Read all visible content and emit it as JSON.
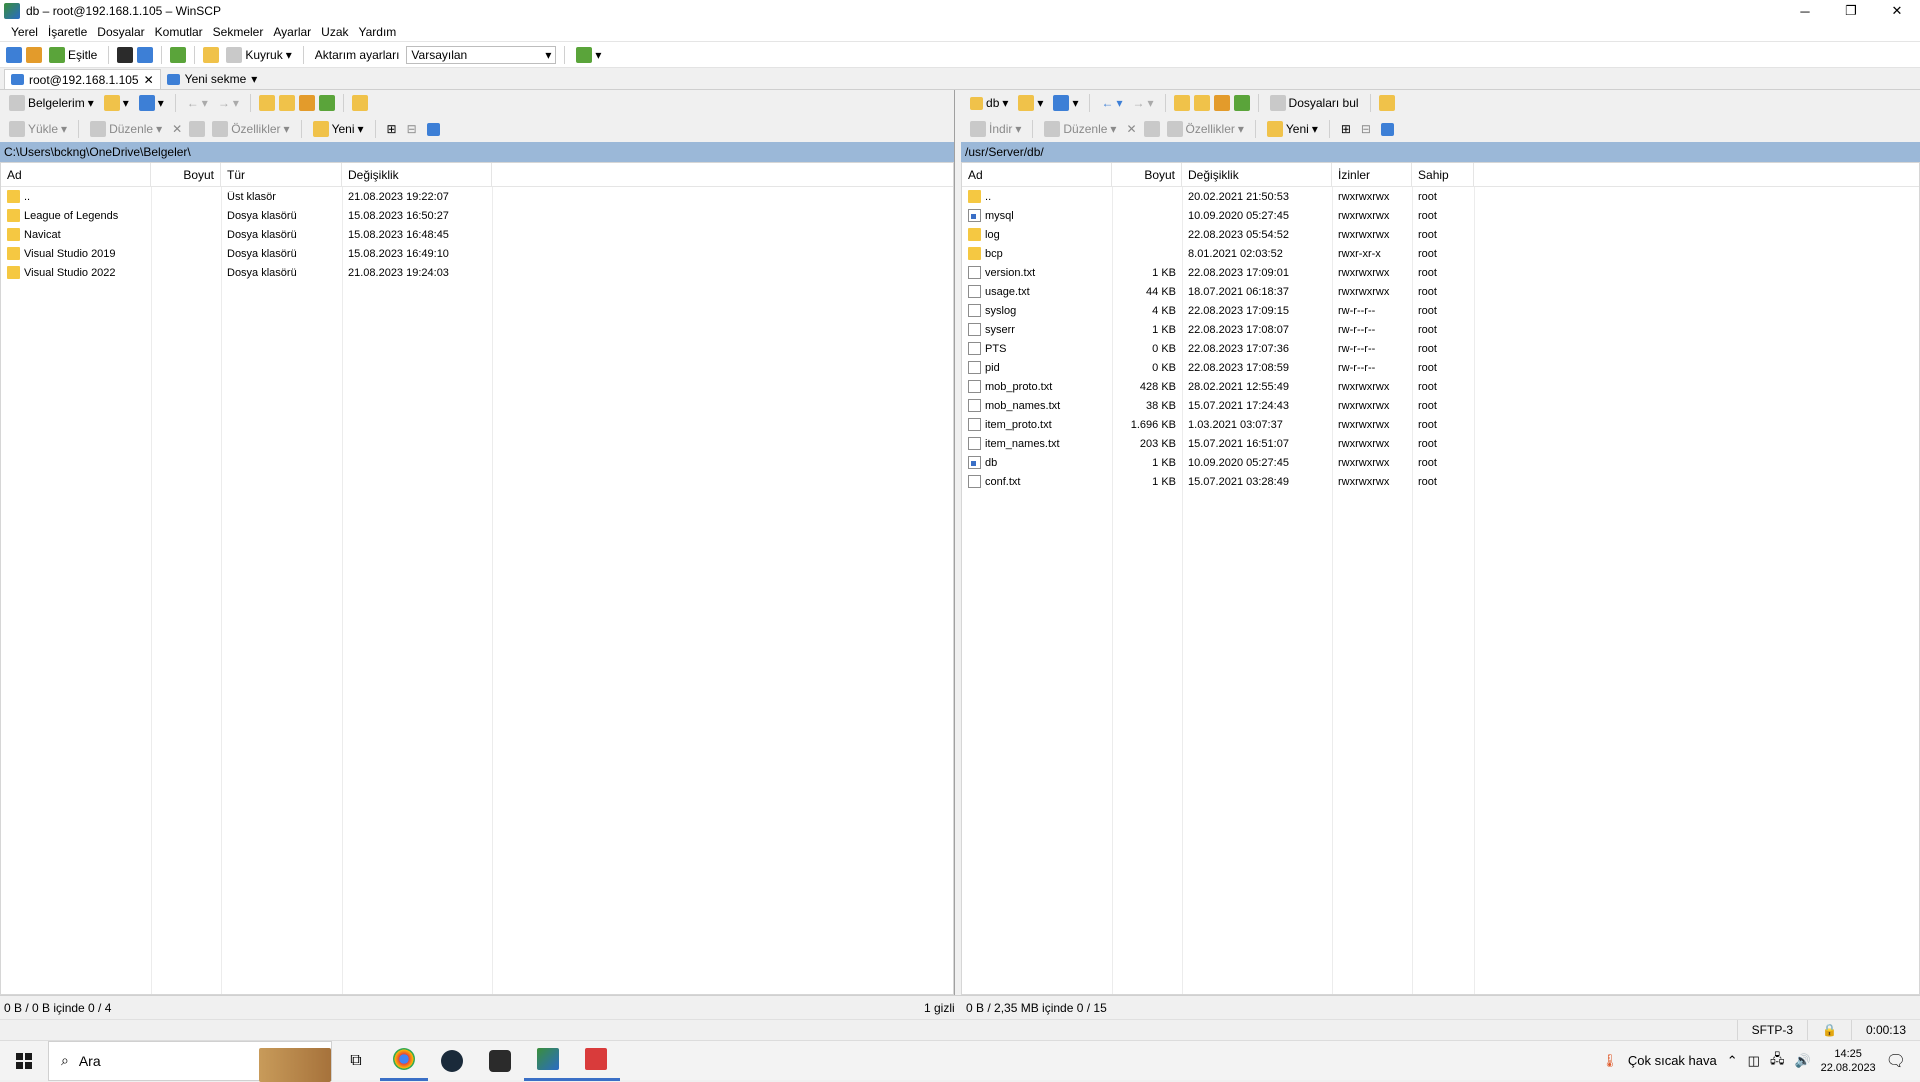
{
  "window": {
    "title": "db – root@192.168.1.105 – WinSCP",
    "minimize": "─",
    "restore": "❐",
    "close": "✕"
  },
  "menu": [
    "Yerel",
    "İşaretle",
    "Dosyalar",
    "Komutlar",
    "Sekmeler",
    "Ayarlar",
    "Uzak",
    "Yardım"
  ],
  "toolbar": {
    "sync_label": "Eşitle",
    "queue_label": "Kuyruk",
    "transfer_label": "Aktarım ayarları",
    "transfer_value": "Varsayılan"
  },
  "tabs": [
    {
      "label": "root@192.168.1.105",
      "close": "✕"
    },
    {
      "label": "Yeni sekme"
    }
  ],
  "left": {
    "location": "Belgelerim",
    "actions": {
      "upload": "Yükle",
      "edit": "Düzenle",
      "properties": "Özellikler",
      "new": "Yeni"
    },
    "path": "C:\\Users\\bckng\\OneDrive\\Belgeler\\",
    "columns": [
      "Ad",
      "Boyut",
      "Tür",
      "Değişiklik"
    ],
    "rows": [
      {
        "name": "..",
        "size": "",
        "type": "Üst klasör",
        "modified": "21.08.2023 19:22:07",
        "icon": "up"
      },
      {
        "name": "League of Legends",
        "size": "",
        "type": "Dosya klasörü",
        "modified": "15.08.2023 16:50:27",
        "icon": "folder"
      },
      {
        "name": "Navicat",
        "size": "",
        "type": "Dosya klasörü",
        "modified": "15.08.2023 16:48:45",
        "icon": "folder"
      },
      {
        "name": "Visual Studio 2019",
        "size": "",
        "type": "Dosya klasörü",
        "modified": "15.08.2023 16:49:10",
        "icon": "folder"
      },
      {
        "name": "Visual Studio 2022",
        "size": "",
        "type": "Dosya klasörü",
        "modified": "21.08.2023 19:24:03",
        "icon": "folder"
      }
    ],
    "status": "0 B / 0 B içinde 0 / 4",
    "hidden": "1 gizli"
  },
  "right": {
    "location": "db",
    "find_label": "Dosyaları bul",
    "actions": {
      "download": "İndir",
      "edit": "Düzenle",
      "properties": "Özellikler",
      "new": "Yeni"
    },
    "path": "/usr/Server/db/",
    "columns": [
      "Ad",
      "Boyut",
      "Değişiklik",
      "İzinler",
      "Sahip"
    ],
    "rows": [
      {
        "name": "..",
        "size": "",
        "modified": "20.02.2021 21:50:53",
        "perm": "rwxrwxrwx",
        "owner": "root",
        "icon": "up"
      },
      {
        "name": "mysql",
        "size": "",
        "modified": "10.09.2020 05:27:45",
        "perm": "rwxrwxrwx",
        "owner": "root",
        "icon": "link"
      },
      {
        "name": "log",
        "size": "",
        "modified": "22.08.2023 05:54:52",
        "perm": "rwxrwxrwx",
        "owner": "root",
        "icon": "folder"
      },
      {
        "name": "bcp",
        "size": "",
        "modified": "8.01.2021 02:03:52",
        "perm": "rwxr-xr-x",
        "owner": "root",
        "icon": "folder"
      },
      {
        "name": "version.txt",
        "size": "1 KB",
        "modified": "22.08.2023 17:09:01",
        "perm": "rwxrwxrwx",
        "owner": "root",
        "icon": "file"
      },
      {
        "name": "usage.txt",
        "size": "44 KB",
        "modified": "18.07.2021 06:18:37",
        "perm": "rwxrwxrwx",
        "owner": "root",
        "icon": "file"
      },
      {
        "name": "syslog",
        "size": "4 KB",
        "modified": "22.08.2023 17:09:15",
        "perm": "rw-r--r--",
        "owner": "root",
        "icon": "file"
      },
      {
        "name": "syserr",
        "size": "1 KB",
        "modified": "22.08.2023 17:08:07",
        "perm": "rw-r--r--",
        "owner": "root",
        "icon": "file"
      },
      {
        "name": "PTS",
        "size": "0 KB",
        "modified": "22.08.2023 17:07:36",
        "perm": "rw-r--r--",
        "owner": "root",
        "icon": "file"
      },
      {
        "name": "pid",
        "size": "0 KB",
        "modified": "22.08.2023 17:08:59",
        "perm": "rw-r--r--",
        "owner": "root",
        "icon": "file"
      },
      {
        "name": "mob_proto.txt",
        "size": "428 KB",
        "modified": "28.02.2021 12:55:49",
        "perm": "rwxrwxrwx",
        "owner": "root",
        "icon": "file"
      },
      {
        "name": "mob_names.txt",
        "size": "38 KB",
        "modified": "15.07.2021 17:24:43",
        "perm": "rwxrwxrwx",
        "owner": "root",
        "icon": "file"
      },
      {
        "name": "item_proto.txt",
        "size": "1.696 KB",
        "modified": "1.03.2021 03:07:37",
        "perm": "rwxrwxrwx",
        "owner": "root",
        "icon": "file"
      },
      {
        "name": "item_names.txt",
        "size": "203 KB",
        "modified": "15.07.2021 16:51:07",
        "perm": "rwxrwxrwx",
        "owner": "root",
        "icon": "file"
      },
      {
        "name": "db",
        "size": "1 KB",
        "modified": "10.09.2020 05:27:45",
        "perm": "rwxrwxrwx",
        "owner": "root",
        "icon": "link"
      },
      {
        "name": "conf.txt",
        "size": "1 KB",
        "modified": "15.07.2021 03:28:49",
        "perm": "rwxrwxrwx",
        "owner": "root",
        "icon": "file"
      }
    ],
    "status": "0 B / 2,35 MB içinde 0 / 15"
  },
  "statusbar": {
    "protocol": "SFTP-3",
    "elapsed": "0:00:13"
  },
  "taskbar": {
    "search_placeholder": "Ara",
    "weather": "Çok sıcak hava",
    "time": "14:25",
    "date": "22.08.2023"
  }
}
